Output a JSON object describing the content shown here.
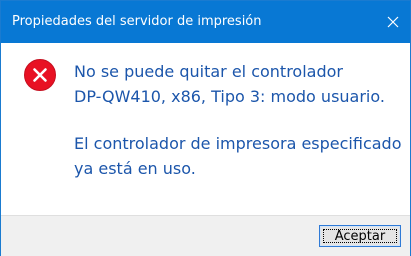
{
  "window": {
    "title": "Propiedades del servidor de impresión",
    "close_icon": "close-icon",
    "accent_color": "#0878d4"
  },
  "message": {
    "icon": "error-icon",
    "line1": "No se puede quitar el controlador",
    "line2": "DP-QW410, x86, Tipo 3: modo usuario.",
    "line3": "El controlador de impresora especificado",
    "line4": "ya está en uso.",
    "text_color": "#1c56ab"
  },
  "footer": {
    "ok_label": "Aceptar"
  }
}
